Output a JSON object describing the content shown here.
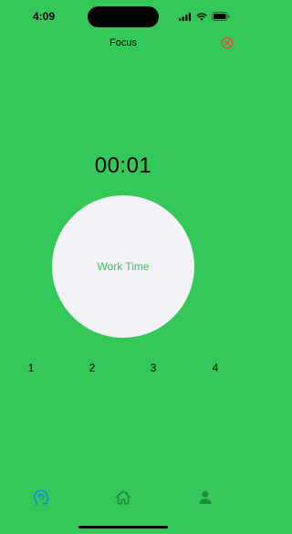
{
  "status_bar": {
    "time": "4:09",
    "icons": [
      "signal-icon",
      "wifi-icon",
      "battery-icon"
    ]
  },
  "nav": {
    "title": "Focus",
    "close_icon": "close-circle-icon",
    "close_color": "#ff3b30"
  },
  "timer": {
    "display": "00:01",
    "mode_label": "Work Time"
  },
  "sessions": [
    "1",
    "2",
    "3",
    "4"
  ],
  "tab_bar": {
    "items": [
      {
        "icon": "brain-head-icon",
        "selected": true,
        "color": "#0a84ff"
      },
      {
        "icon": "home-icon",
        "selected": false,
        "color": "#1f8a3a"
      },
      {
        "icon": "person-icon",
        "selected": false,
        "color": "#1f8a3a"
      }
    ]
  },
  "colors": {
    "background": "#34c759",
    "circle": "#f2f2f7",
    "accent": "#34c759"
  }
}
